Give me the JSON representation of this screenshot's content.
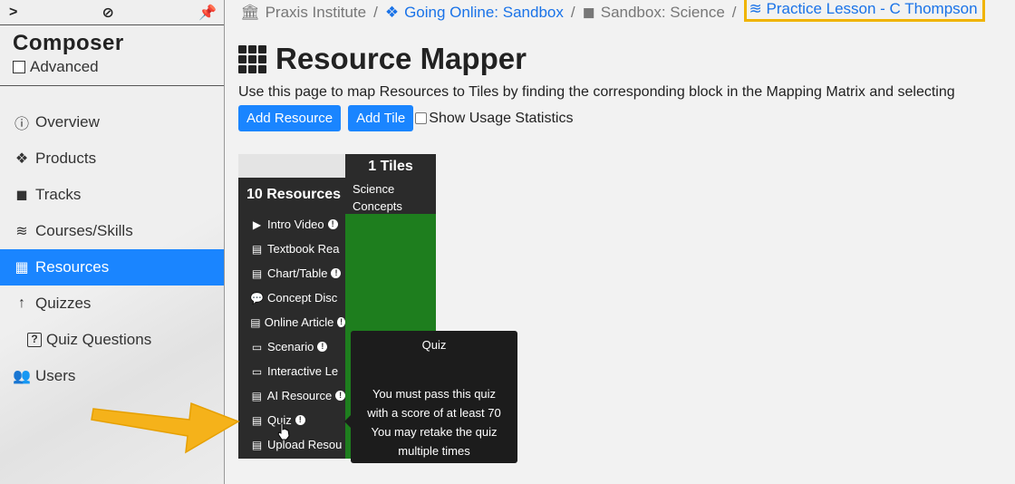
{
  "sidebar": {
    "composer_title": "Composer",
    "advanced_label": "Advanced",
    "items": [
      {
        "label": "Overview",
        "icon": "info-circle-icon",
        "glyph": "ⓘ"
      },
      {
        "label": "Products",
        "icon": "cubes-icon",
        "glyph": "❖"
      },
      {
        "label": "Tracks",
        "icon": "cube-icon",
        "glyph": "◼"
      },
      {
        "label": "Courses/Skills",
        "icon": "layers-icon",
        "glyph": "≋"
      },
      {
        "label": "Resources",
        "icon": "grid-icon",
        "glyph": "▦",
        "active": true
      },
      {
        "label": "Quizzes",
        "icon": "arrow-up-icon",
        "glyph": "↑"
      },
      {
        "label": "Quiz Questions",
        "icon": "question-square-icon",
        "glyph": "?"
      },
      {
        "label": "Users",
        "icon": "users-icon",
        "glyph": "👥"
      }
    ]
  },
  "breadcrumb": {
    "items": [
      "Praxis Institute",
      "Going Online: Sandbox",
      "Sandbox: Science",
      "Practice Lesson - C Thompson"
    ]
  },
  "page": {
    "title": "Resource Mapper",
    "description": "Use this page to map Resources to Tiles by finding the corresponding block in the Mapping Matrix and selecting",
    "add_resource": "Add Resource",
    "add_tile": "Add Tile",
    "show_usage": "Show Usage Statistics"
  },
  "matrix": {
    "resources_header": "10 Resources",
    "tiles_header": "1 Tiles",
    "tile_name_line1": "Science",
    "tile_name_line2": "Concepts",
    "tile_color": "#1e7e1e",
    "resources": [
      {
        "label": "Intro Video",
        "icon": "video-icon",
        "glyph": "▶",
        "warn": true
      },
      {
        "label": "Textbook Rea",
        "icon": "document-icon",
        "glyph": "▤",
        "warn": false
      },
      {
        "label": "Chart/Table",
        "icon": "document-icon",
        "glyph": "▤",
        "warn": true
      },
      {
        "label": "Concept Disc",
        "icon": "comments-icon",
        "glyph": "💬",
        "warn": false
      },
      {
        "label": "Online Article",
        "icon": "document-icon",
        "glyph": "▤",
        "warn": true
      },
      {
        "label": "Scenario",
        "icon": "presentation-icon",
        "glyph": "▭",
        "warn": true
      },
      {
        "label": "Interactive Le",
        "icon": "presentation-icon",
        "glyph": "▭",
        "warn": false
      },
      {
        "label": "AI Resource",
        "icon": "clipboard-icon",
        "glyph": "▤",
        "warn": true
      },
      {
        "label": "Quiz",
        "icon": "clipboard-icon",
        "glyph": "▤",
        "warn": true
      },
      {
        "label": "Upload Resou",
        "icon": "document-icon",
        "glyph": "▤",
        "warn": false
      }
    ]
  },
  "tooltip": {
    "title": "Quiz",
    "line1": "You must pass this quiz",
    "line2": "with a score of at least 70",
    "line3": "You may retake the quiz",
    "line4": "multiple times"
  },
  "colors": {
    "accent": "#1a85ff",
    "highlight_box": "#f0b400",
    "callout_arrow": "#f5b21a"
  }
}
